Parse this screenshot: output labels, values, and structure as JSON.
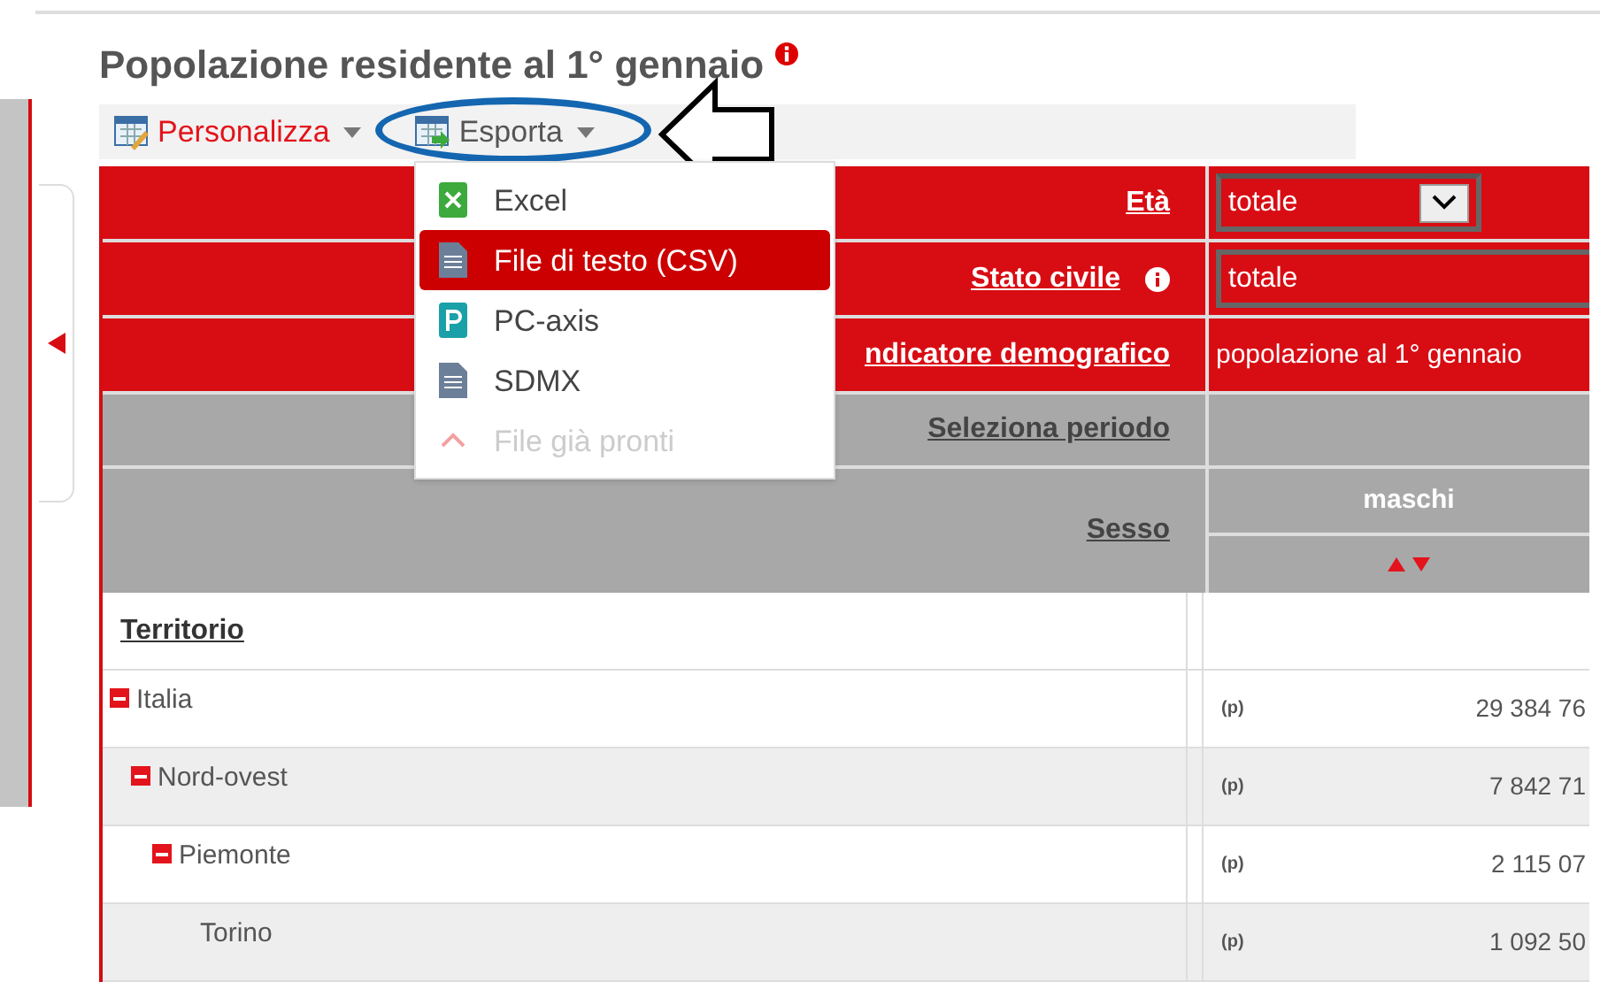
{
  "title": "Popolazione residente al 1° gennaio",
  "toolbar": [
    {
      "label": "Personalizza",
      "kind": "customize",
      "selected": false
    },
    {
      "label": "Esporta",
      "kind": "export",
      "selected": true
    }
  ],
  "export_menu": [
    {
      "label": "Excel",
      "kind": "excel",
      "selected": false,
      "disabled": false
    },
    {
      "label": "File di testo (CSV)",
      "kind": "doc",
      "selected": true,
      "disabled": false
    },
    {
      "label": "PC-axis",
      "kind": "pcaxis",
      "selected": false,
      "disabled": false
    },
    {
      "label": "SDMX",
      "kind": "doc",
      "selected": false,
      "disabled": false
    },
    {
      "label": "File già pronti",
      "kind": "caret",
      "selected": false,
      "disabled": true
    }
  ],
  "filters": [
    {
      "label": "Età",
      "kind": "select",
      "value": "totale",
      "info": false
    },
    {
      "label": "Stato civile",
      "kind": "field",
      "value": "totale",
      "info": true
    },
    {
      "label": "ndicatore demografico",
      "kind": "text",
      "value": "popolazione al 1° gennaio",
      "info": false
    }
  ],
  "period": {
    "label": "Seleziona periodo"
  },
  "sex": {
    "label": "Sesso",
    "column": "maschi"
  },
  "territory_header": "Territorio",
  "rows": [
    {
      "name": "Italia",
      "flag": "(p)",
      "value": "29 384 76",
      "expanded": true,
      "children": [
        {
          "name": "Nord-ovest",
          "flag": "(p)",
          "value": "7 842 71",
          "expanded": true,
          "children": [
            {
              "name": "Piemonte",
              "flag": "(p)",
              "value": "2 115 07",
              "expanded": true,
              "children": [
                {
                  "name": "Torino",
                  "flag": "(p)",
                  "value": "1 092 50"
                }
              ]
            }
          ]
        }
      ]
    }
  ]
}
